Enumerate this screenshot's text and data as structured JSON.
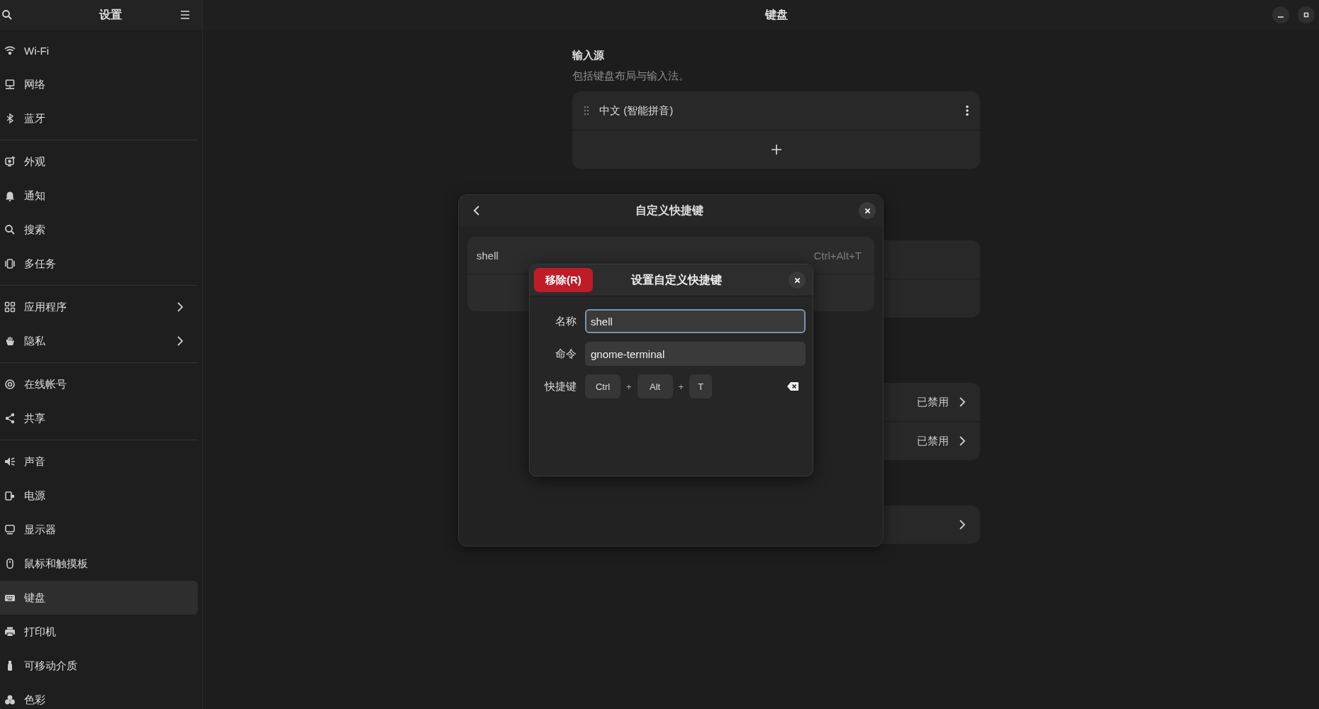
{
  "sidebar": {
    "title": "设置",
    "groups": [
      [
        {
          "label": "Wi-Fi",
          "kind": "page",
          "selected": false
        },
        {
          "label": "网络",
          "kind": "page",
          "selected": false
        },
        {
          "label": "蓝牙",
          "kind": "page",
          "selected": false
        }
      ],
      [
        {
          "label": "外观",
          "kind": "page",
          "selected": false
        },
        {
          "label": "通知",
          "kind": "page",
          "selected": false
        },
        {
          "label": "搜索",
          "kind": "page",
          "selected": false
        },
        {
          "label": "多任务",
          "kind": "page",
          "selected": false
        }
      ],
      [
        {
          "label": "应用程序",
          "kind": "submenu",
          "selected": false
        },
        {
          "label": "隐私",
          "kind": "submenu",
          "selected": false
        }
      ],
      [
        {
          "label": "在线帐号",
          "kind": "page",
          "selected": false
        },
        {
          "label": "共享",
          "kind": "page",
          "selected": false
        }
      ],
      [
        {
          "label": "声音",
          "kind": "page",
          "selected": false
        },
        {
          "label": "电源",
          "kind": "page",
          "selected": false
        },
        {
          "label": "显示器",
          "kind": "page",
          "selected": false
        },
        {
          "label": "鼠标和触摸板",
          "kind": "page",
          "selected": false
        },
        {
          "label": "键盘",
          "kind": "page",
          "selected": true
        },
        {
          "label": "打印机",
          "kind": "page",
          "selected": false
        },
        {
          "label": "可移动介质",
          "kind": "page",
          "selected": false
        },
        {
          "label": "色彩",
          "kind": "page",
          "selected": false
        }
      ]
    ]
  },
  "page": {
    "title": "键盘",
    "input_sources": {
      "heading": "输入源",
      "subtitle": "包括键盘布局与输入法。",
      "items": [
        {
          "label": "中文 (智能拼音)"
        }
      ]
    },
    "settings_rows": [
      {
        "value": "已禁用"
      },
      {
        "value": "已禁用"
      }
    ]
  },
  "shortcuts_dialog": {
    "title": "自定义快捷键",
    "rows": [
      {
        "name": "shell",
        "shortcut": "Ctrl+Alt+T"
      }
    ]
  },
  "edit_dialog": {
    "remove_button": "移除(R)",
    "title": "设置自定义快捷键",
    "fields": [
      {
        "label": "名称",
        "value": "shell",
        "focused": true
      },
      {
        "label": "命令",
        "value": "gnome-terminal",
        "focused": false
      }
    ],
    "shortcut": {
      "label": "快捷键",
      "keys": [
        "Ctrl",
        "Alt",
        "T"
      ],
      "separators": [
        "+",
        "+"
      ]
    }
  }
}
